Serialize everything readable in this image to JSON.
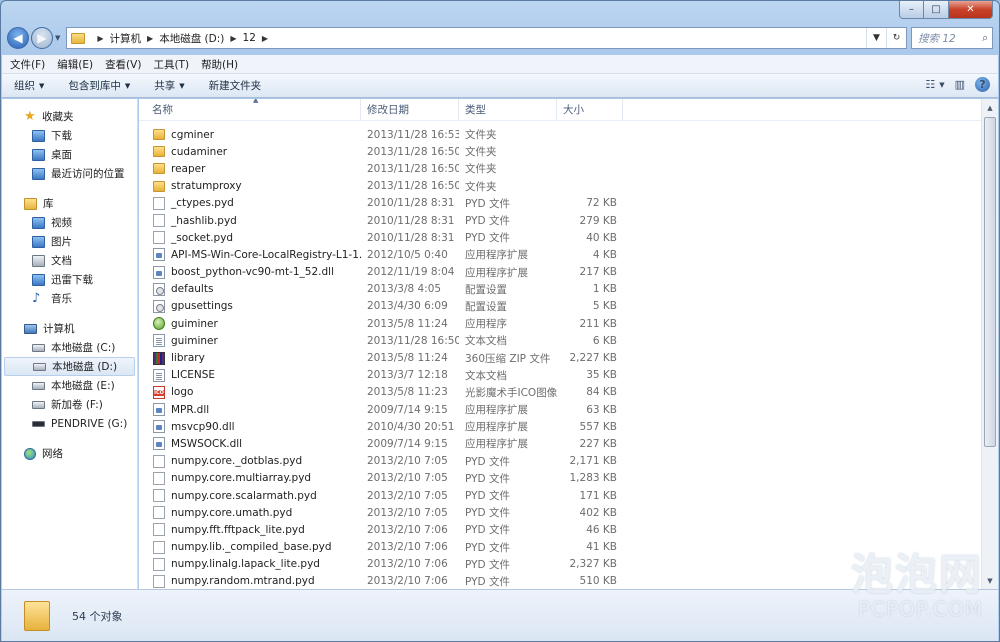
{
  "window": {
    "caption_buttons": {
      "minimize": "–",
      "maximize": "□",
      "close": "✕"
    }
  },
  "address": {
    "crumbs": [
      "计算机",
      "本地磁盘 (D:)",
      "12"
    ],
    "search_placeholder": "搜索 12"
  },
  "menu": [
    "文件(F)",
    "编辑(E)",
    "查看(V)",
    "工具(T)",
    "帮助(H)"
  ],
  "toolbar": {
    "organize": "组织",
    "include_library": "包含到库中",
    "share": "共享",
    "new_folder": "新建文件夹"
  },
  "nav": {
    "favorites": "收藏夹",
    "fav_items": [
      "下载",
      "桌面",
      "最近访问的位置"
    ],
    "library": "库",
    "lib_items": [
      "视频",
      "图片",
      "文档",
      "迅雷下载",
      "音乐"
    ],
    "computer": "计算机",
    "drives": [
      "本地磁盘 (C:)",
      "本地磁盘 (D:)",
      "本地磁盘 (E:)",
      "新加卷 (F:)",
      "PENDRIVE (G:)"
    ],
    "network": "网络"
  },
  "columns": {
    "name": "名称",
    "date": "修改日期",
    "type": "类型",
    "size": "大小"
  },
  "files": [
    {
      "name": "cgminer",
      "date": "2013/11/28 16:53",
      "type": "文件夹",
      "size": "",
      "icon": "folder"
    },
    {
      "name": "cudaminer",
      "date": "2013/11/28 16:50",
      "type": "文件夹",
      "size": "",
      "icon": "folder"
    },
    {
      "name": "reaper",
      "date": "2013/11/28 16:50",
      "type": "文件夹",
      "size": "",
      "icon": "folder"
    },
    {
      "name": "stratumproxy",
      "date": "2013/11/28 16:50",
      "type": "文件夹",
      "size": "",
      "icon": "folder"
    },
    {
      "name": "_ctypes.pyd",
      "date": "2010/11/28 8:31",
      "type": "PYD 文件",
      "size": "72 KB",
      "icon": "file"
    },
    {
      "name": "_hashlib.pyd",
      "date": "2010/11/28 8:31",
      "type": "PYD 文件",
      "size": "279 KB",
      "icon": "file"
    },
    {
      "name": "_socket.pyd",
      "date": "2010/11/28 8:31",
      "type": "PYD 文件",
      "size": "40 KB",
      "icon": "file"
    },
    {
      "name": "API-MS-Win-Core-LocalRegistry-L1-1...",
      "date": "2012/10/5 0:40",
      "type": "应用程序扩展",
      "size": "4 KB",
      "icon": "dll"
    },
    {
      "name": "boost_python-vc90-mt-1_52.dll",
      "date": "2012/11/19 8:04",
      "type": "应用程序扩展",
      "size": "217 KB",
      "icon": "dll"
    },
    {
      "name": "defaults",
      "date": "2013/3/8 4:05",
      "type": "配置设置",
      "size": "1 KB",
      "icon": "ini"
    },
    {
      "name": "gpusettings",
      "date": "2013/4/30 6:09",
      "type": "配置设置",
      "size": "5 KB",
      "icon": "ini"
    },
    {
      "name": "guiminer",
      "date": "2013/5/8 11:24",
      "type": "应用程序",
      "size": "211 KB",
      "icon": "exe"
    },
    {
      "name": "guiminer",
      "date": "2013/11/28 16:50",
      "type": "文本文档",
      "size": "6 KB",
      "icon": "txt"
    },
    {
      "name": "library",
      "date": "2013/5/8 11:24",
      "type": "360压缩 ZIP 文件",
      "size": "2,227 KB",
      "icon": "zip"
    },
    {
      "name": "LICENSE",
      "date": "2013/3/7 12:18",
      "type": "文本文档",
      "size": "35 KB",
      "icon": "txt"
    },
    {
      "name": "logo",
      "date": "2013/5/8 11:23",
      "type": "光影魔术手ICO图像",
      "size": "84 KB",
      "icon": "ico"
    },
    {
      "name": "MPR.dll",
      "date": "2009/7/14 9:15",
      "type": "应用程序扩展",
      "size": "63 KB",
      "icon": "dll"
    },
    {
      "name": "msvcp90.dll",
      "date": "2010/4/30 20:51",
      "type": "应用程序扩展",
      "size": "557 KB",
      "icon": "dll"
    },
    {
      "name": "MSWSOCK.dll",
      "date": "2009/7/14 9:15",
      "type": "应用程序扩展",
      "size": "227 KB",
      "icon": "dll"
    },
    {
      "name": "numpy.core._dotblas.pyd",
      "date": "2013/2/10 7:05",
      "type": "PYD 文件",
      "size": "2,171 KB",
      "icon": "file"
    },
    {
      "name": "numpy.core.multiarray.pyd",
      "date": "2013/2/10 7:05",
      "type": "PYD 文件",
      "size": "1,283 KB",
      "icon": "file"
    },
    {
      "name": "numpy.core.scalarmath.pyd",
      "date": "2013/2/10 7:05",
      "type": "PYD 文件",
      "size": "171 KB",
      "icon": "file"
    },
    {
      "name": "numpy.core.umath.pyd",
      "date": "2013/2/10 7:05",
      "type": "PYD 文件",
      "size": "402 KB",
      "icon": "file"
    },
    {
      "name": "numpy.fft.fftpack_lite.pyd",
      "date": "2013/2/10 7:06",
      "type": "PYD 文件",
      "size": "46 KB",
      "icon": "file"
    },
    {
      "name": "numpy.lib._compiled_base.pyd",
      "date": "2013/2/10 7:06",
      "type": "PYD 文件",
      "size": "41 KB",
      "icon": "file"
    },
    {
      "name": "numpy.linalg.lapack_lite.pyd",
      "date": "2013/2/10 7:06",
      "type": "PYD 文件",
      "size": "2,327 KB",
      "icon": "file"
    },
    {
      "name": "numpy.random.mtrand.pyd",
      "date": "2013/2/10 7:06",
      "type": "PYD 文件",
      "size": "510 KB",
      "icon": "file"
    }
  ],
  "status": {
    "item_count": "54 个对象"
  },
  "watermark": {
    "cn": "泡泡网",
    "en": "PCPOP.COM"
  }
}
